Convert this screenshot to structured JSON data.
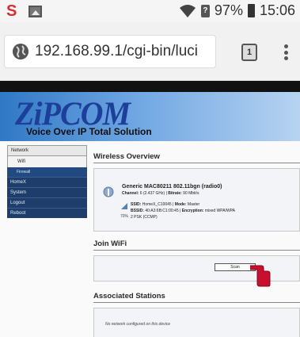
{
  "status_bar": {
    "battery_percent": "97%",
    "time": "15:06",
    "sim_label": "?"
  },
  "browser": {
    "url": "192.168.99.1/cgi-bin/luci",
    "tab_count": "1"
  },
  "banner": {
    "logo_text": "ZiPCOM",
    "tagline": "Voice Over IP Total Solution"
  },
  "sidebar": {
    "section": "Network",
    "sub_item": "Wifi",
    "sub_sub_item": "Firewall",
    "items": [
      "HomeX",
      "System",
      "Logout",
      "Reboot"
    ]
  },
  "wireless_overview": {
    "title": "Wireless Overview",
    "radio_name": "Generic MAC80211 802.11bgn (radio0)",
    "channel_label": "Channel:",
    "channel_value": "6 (2.437 GHz)",
    "bitrate_label": "Bitrate:",
    "bitrate_value": "90 Mbit/s",
    "ssid_label": "SSID:",
    "ssid_value": "HomeX_C10045",
    "mode_label": "Mode:",
    "mode_value": "Master",
    "bssid_label": "BSSID:",
    "bssid_value": "40:A3:6B:C1:00:45",
    "encryption_label": "Encryption:",
    "encryption_value": "mixed WPA/WPA",
    "encryption_cont": "2 PSK (CCMP)",
    "signal_percent": "70%"
  },
  "join_wifi": {
    "title": "Join WiFi",
    "scan_label": "Scan"
  },
  "associated_stations": {
    "title": "Associated Stations",
    "empty_message": "No network configured on this device"
  },
  "colors": {
    "sidebar_nav": "#1e3d6a",
    "banner_start": "#2f78c4",
    "logo": "#1d3f9a",
    "hand_red": "#c8102e"
  }
}
